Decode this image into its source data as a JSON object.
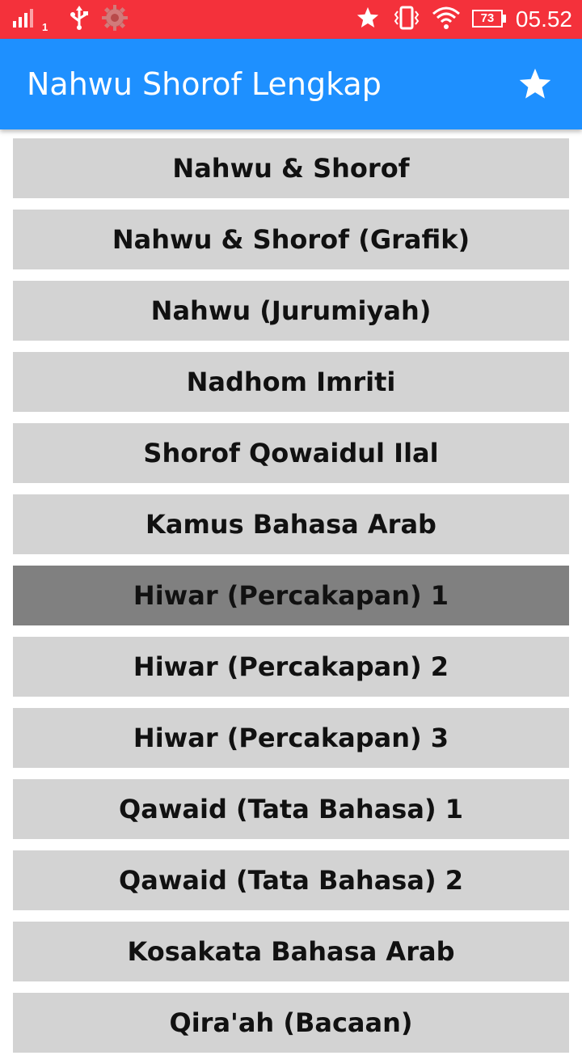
{
  "status_bar": {
    "signal_sim_label": "1",
    "battery_level": "73",
    "time": "05.52",
    "icons": [
      "signal-icon",
      "usb-icon",
      "settings-gear-icon",
      "star-icon",
      "vibrate-icon",
      "wifi-icon",
      "battery-icon"
    ]
  },
  "app_bar": {
    "title": "Nahwu Shorof Lengkap",
    "action_icon": "star-icon"
  },
  "colors": {
    "status_bar": "#f4313b",
    "app_bar": "#1e90ff",
    "item_bg": "#d3d3d3",
    "item_selected_bg": "#808080"
  },
  "menu": {
    "selected_index": 6,
    "items": [
      {
        "label": "Nahwu & Shorof"
      },
      {
        "label": "Nahwu & Shorof (Grafik)"
      },
      {
        "label": "Nahwu (Jurumiyah)"
      },
      {
        "label": "Nadhom Imriti"
      },
      {
        "label": "Shorof Qowaidul Ilal"
      },
      {
        "label": "Kamus Bahasa Arab"
      },
      {
        "label": "Hiwar (Percakapan) 1"
      },
      {
        "label": "Hiwar (Percakapan) 2"
      },
      {
        "label": "Hiwar (Percakapan) 3"
      },
      {
        "label": "Qawaid (Tata Bahasa) 1"
      },
      {
        "label": "Qawaid (Tata Bahasa) 2"
      },
      {
        "label": "Kosakata Bahasa Arab"
      },
      {
        "label": "Qira'ah (Bacaan)"
      }
    ]
  }
}
